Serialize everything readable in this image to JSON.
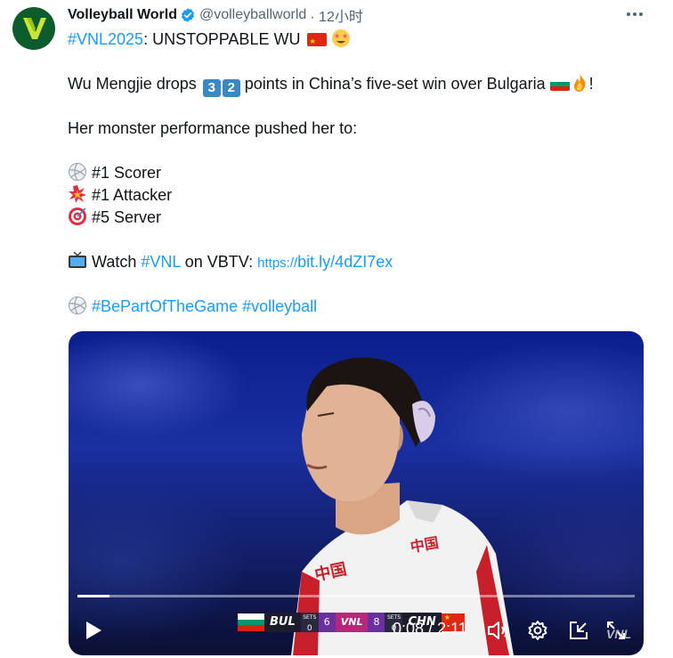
{
  "author": {
    "name": "Volleyball World",
    "handle": "@volleyballworld",
    "time": "· 12小时"
  },
  "tweet": {
    "hashtag_vnl2025": "#VNL2025",
    "headline": ": UNSTOPPABLE WU",
    "line2_before": "Wu Mengjie drops",
    "digit_a": "3",
    "digit_b": "2",
    "line2_after": "points in China’s five-set win over Bulgaria",
    "line2_end": "!",
    "intro": "Her monster performance pushed her to:",
    "stat1": "#1 Scorer",
    "stat2": "#1 Attacker",
    "stat3": "#5 Server",
    "watch_prefix": "Watch",
    "watch_hashtag": "#VNL",
    "watch_mid": "on VBTV:",
    "url_scheme": "https://",
    "url_rest": "bit.ly/4dZI7ex",
    "tag1": "#BePartOfTheGame",
    "tag2": "#volleyball"
  },
  "video": {
    "elapsed": "0:08",
    "separator": "/",
    "duration": "2:11",
    "progress_fraction": 0.057,
    "scorebug": {
      "team1": "BUL",
      "team1_sets_label": "SETS",
      "team1_sets": "0",
      "team1_points": "6",
      "logo": "VNL",
      "team2_points": "8",
      "team2_sets_label": "SETS",
      "team2_sets": "0",
      "team2": "CHN"
    },
    "watermark": "VNL"
  },
  "icons": [
    "volleyball-world-logo",
    "verified-badge-icon",
    "more-icon",
    "china-flag-icon",
    "star-struck-emoji-icon",
    "keycap-digit-icon",
    "bulgaria-flag-icon",
    "fire-emoji-icon",
    "volleyball-icon",
    "collision-icon",
    "direct-hit-icon",
    "television-icon",
    "play-icon",
    "volume-icon",
    "settings-icon",
    "minimize-icon",
    "fullscreen-icon"
  ],
  "colors": {
    "link": "#1d9bf0",
    "text": "#0f1419",
    "muted": "#536471",
    "verified": "#1d9bf0"
  }
}
